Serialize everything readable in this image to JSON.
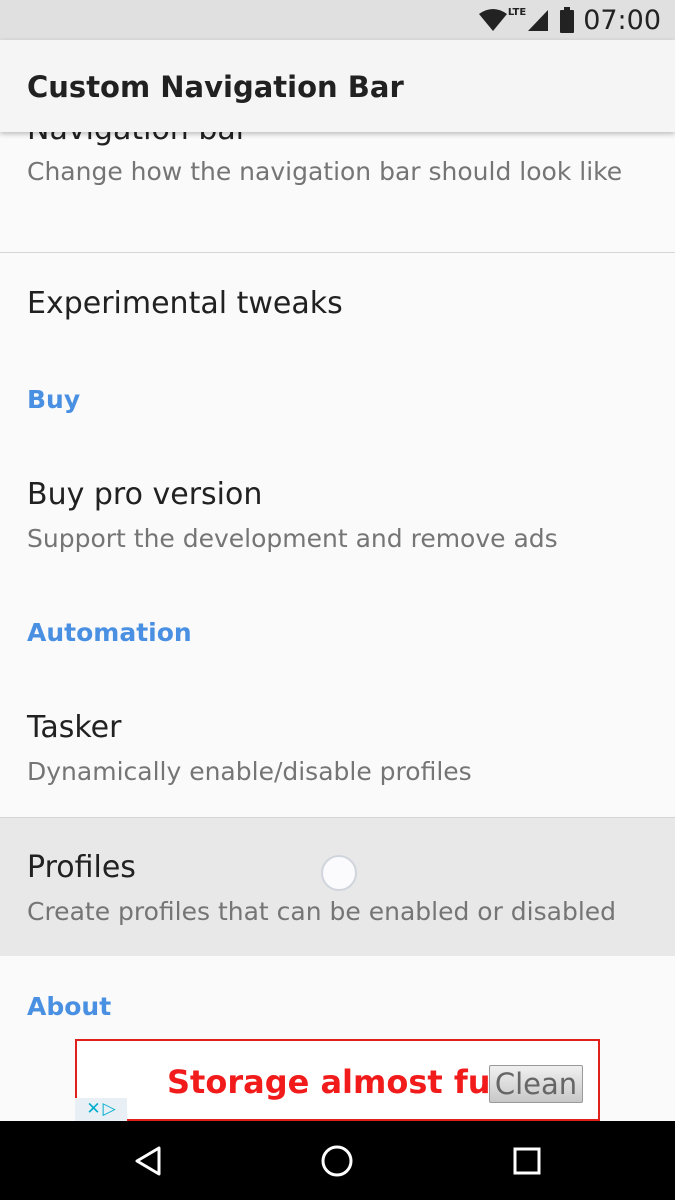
{
  "status_bar": {
    "time": "07:00",
    "network": "LTE"
  },
  "toolbar": {
    "title": "Custom Navigation Bar"
  },
  "prefs": {
    "navigation_bar": {
      "title": "Navigation bar",
      "summary": "Change how the navigation bar should look like"
    },
    "experimental": {
      "title": "Experimental tweaks"
    },
    "buy_category": "Buy",
    "buy_pro": {
      "title": "Buy pro version",
      "summary": "Support the development and remove ads"
    },
    "automation_category": "Automation",
    "tasker": {
      "title": "Tasker",
      "summary": "Dynamically enable/disable profiles"
    },
    "profiles": {
      "title": "Profiles",
      "summary": "Create profiles that can be enabled or disabled"
    },
    "about_category": "About"
  },
  "ad": {
    "message": "Storage almost full",
    "button_label": "Clean"
  },
  "colors": {
    "accent": "#4a90e2",
    "ad_red": "#f21b1b"
  },
  "icons": {
    "wifi": "wifi-icon",
    "signal": "signal-icon",
    "battery": "battery-icon",
    "back": "back-triangle-icon",
    "home": "home-circle-icon",
    "recents": "recents-square-icon",
    "adchoices": "adchoices-icon"
  }
}
